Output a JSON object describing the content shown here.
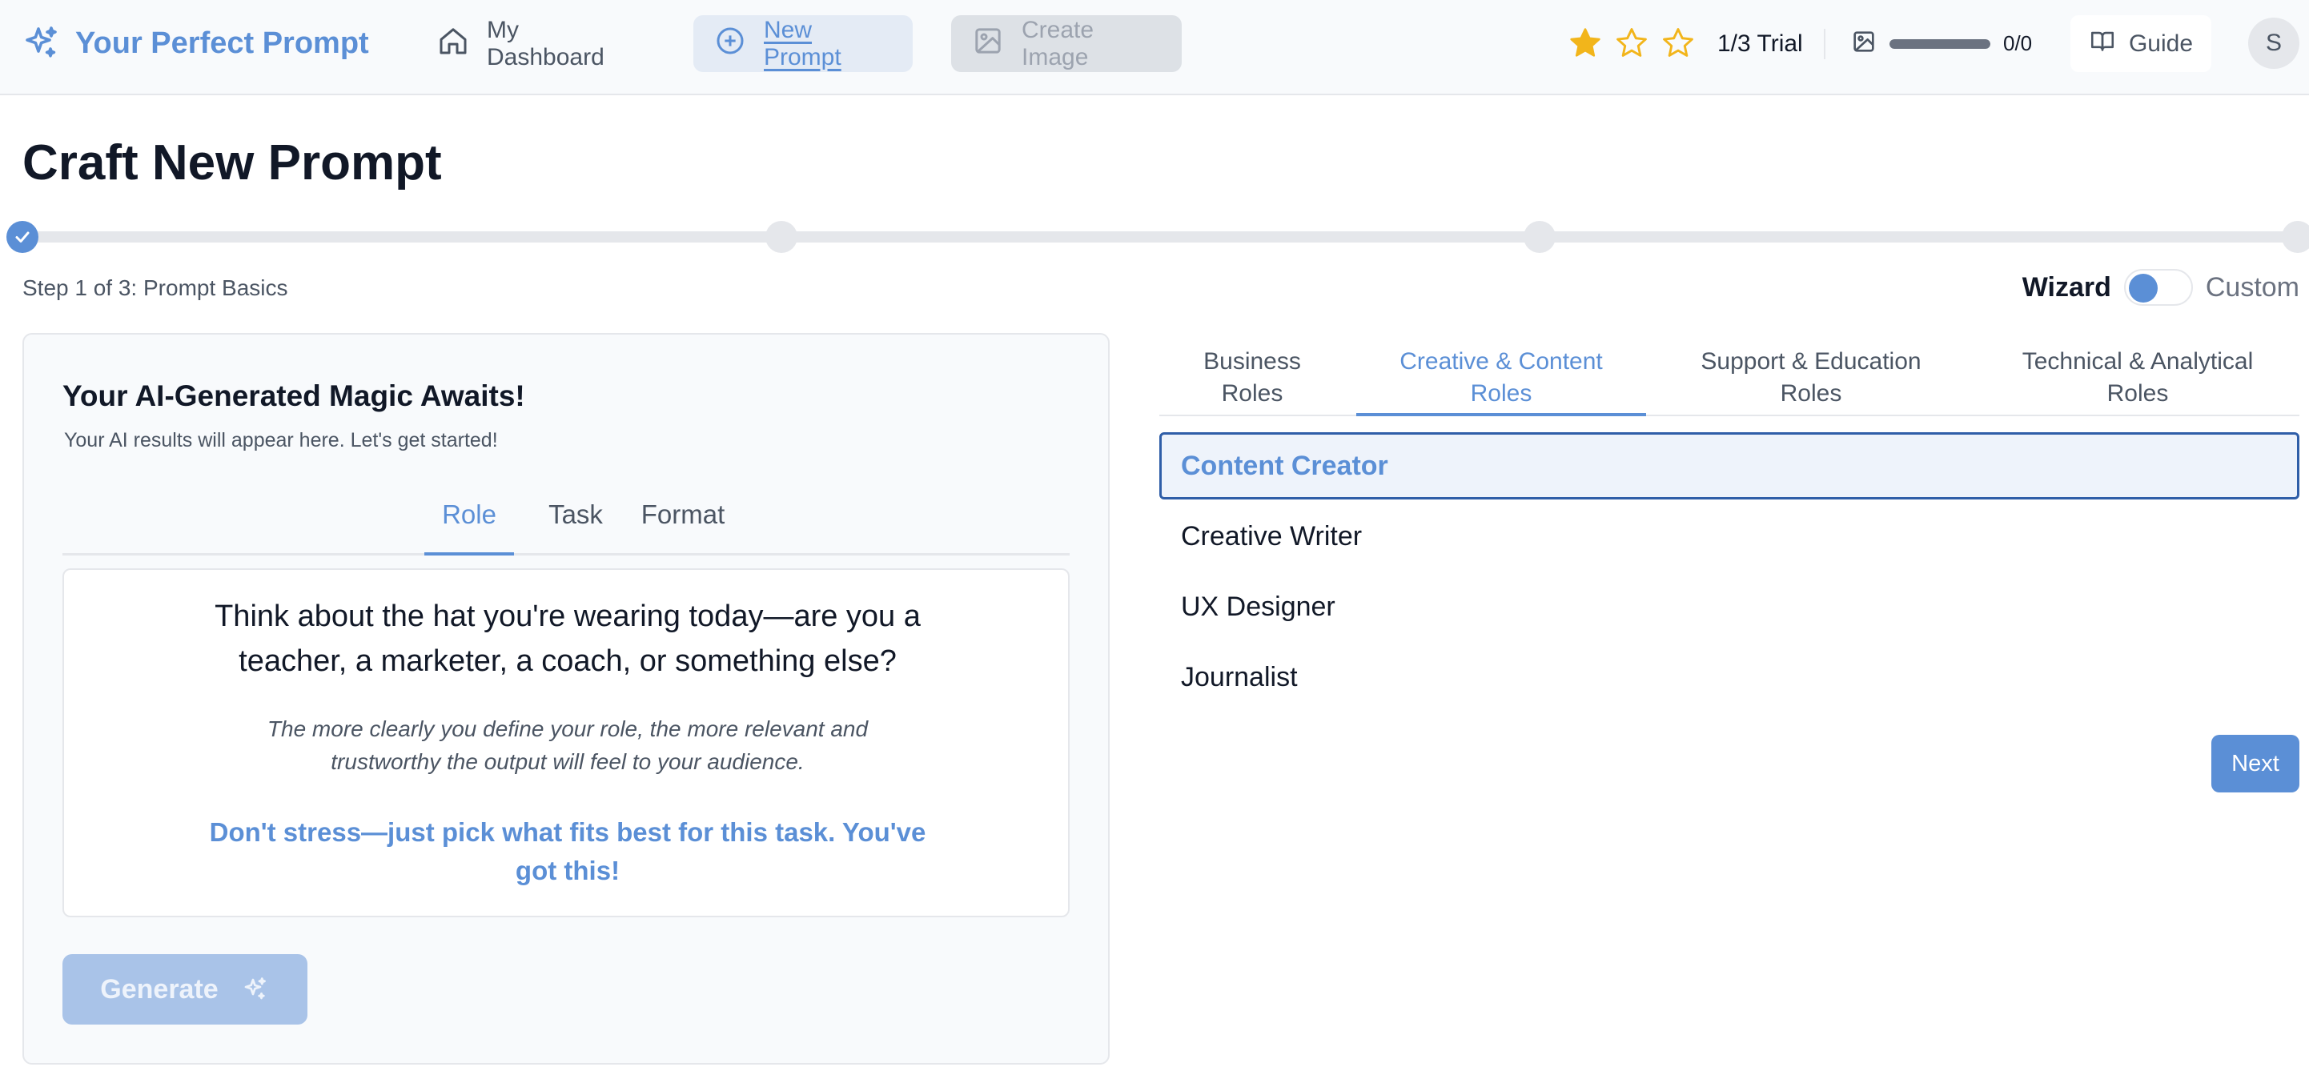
{
  "header": {
    "brand": "Your Perfect Prompt",
    "nav": {
      "dashboard": "My Dashboard",
      "new_prompt": "New Prompt",
      "create_image": "Create Image"
    },
    "rating": {
      "filled": 1,
      "total": 3,
      "color": "#f2b51b"
    },
    "trial_label": "1/3 Trial",
    "image_usage": {
      "label": "0/0",
      "fraction": 1.0
    },
    "guide_label": "Guide",
    "avatar_initial": "S"
  },
  "page": {
    "title": "Craft New Prompt",
    "progress": {
      "current_step": 1,
      "total_steps": 3
    },
    "step_label": "Step 1 of 3: Prompt Basics",
    "mode": {
      "wizard": "Wizard",
      "custom": "Custom",
      "selected": "Wizard"
    }
  },
  "left_panel": {
    "heading": "Your AI-Generated Magic Awaits!",
    "subheading": "Your AI results will appear here. Let's get started!",
    "tabs": [
      "Role",
      "Task",
      "Format"
    ],
    "active_tab": "Role",
    "card": {
      "question": "Think about the hat you're wearing today—are you a teacher, a marketer, a coach, or something else?",
      "hint": "The more clearly you define your role, the more relevant and trustworthy the output will feel to your audience.",
      "encouragement": "Don't stress—just pick what fits best for this task. You've got this!"
    },
    "generate_label": "Generate"
  },
  "right_panel": {
    "categories": [
      {
        "line1": "Business",
        "line2": "Roles"
      },
      {
        "line1": "Creative & Content",
        "line2": "Roles"
      },
      {
        "line1": "Support & Education",
        "line2": "Roles"
      },
      {
        "line1": "Technical & Analytical",
        "line2": "Roles"
      }
    ],
    "active_category": "Creative & Content Roles",
    "roles": [
      "Content Creator",
      "Creative Writer",
      "UX Designer",
      "Journalist"
    ],
    "selected_role": "Content Creator",
    "next_label": "Next"
  },
  "colors": {
    "accent": "#5b8fd6",
    "star": "#f2b51b",
    "selected_border": "#2f5ea8"
  }
}
